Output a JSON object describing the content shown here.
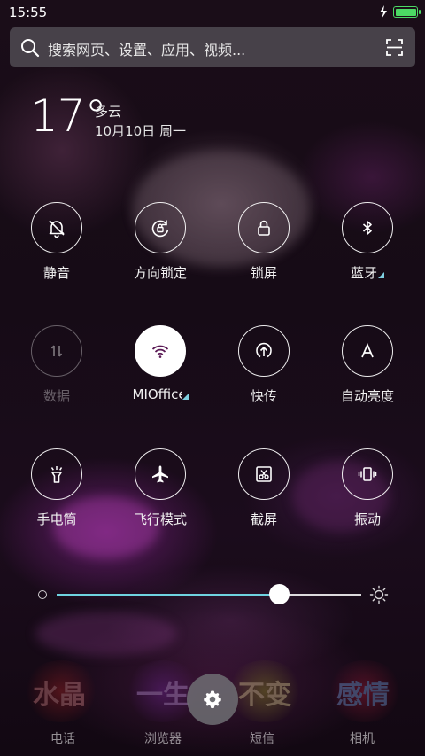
{
  "status_bar": {
    "time": "15:55",
    "battery_level_percent": 100
  },
  "search": {
    "placeholder": "搜索网页、设置、应用、视频..."
  },
  "weather": {
    "temperature": "17°",
    "condition": "多云",
    "date": "10月10日 周一"
  },
  "toggles": [
    {
      "label": "静音",
      "icon": "bell-off-icon",
      "state": "off"
    },
    {
      "label": "方向锁定",
      "icon": "rotation-lock-icon",
      "state": "off"
    },
    {
      "label": "锁屏",
      "icon": "lock-icon",
      "state": "off"
    },
    {
      "label": "蓝牙",
      "icon": "bluetooth-icon",
      "state": "off",
      "has_menu": true
    },
    {
      "label": "数据",
      "icon": "mobile-data-icon",
      "state": "disabled"
    },
    {
      "label": "MIOffice",
      "icon": "wifi-icon",
      "state": "on",
      "has_menu": true
    },
    {
      "label": "快传",
      "icon": "transfer-icon",
      "state": "off"
    },
    {
      "label": "自动亮度",
      "icon": "auto-brightness-icon",
      "state": "off"
    },
    {
      "label": "手电筒",
      "icon": "flashlight-icon",
      "state": "off"
    },
    {
      "label": "飞行模式",
      "icon": "airplane-icon",
      "state": "off"
    },
    {
      "label": "截屏",
      "icon": "screenshot-icon",
      "state": "off"
    },
    {
      "label": "振动",
      "icon": "vibrate-icon",
      "state": "off"
    }
  ],
  "brightness": {
    "level_fraction": 0.73
  },
  "dock": {
    "apps": [
      "电话",
      "浏览器",
      "短信",
      "相机"
    ],
    "tile_texts": [
      "水晶",
      "一生",
      "不变",
      "感情"
    ]
  },
  "colors": {
    "accent": "#6fd3e0",
    "battery": "#4cd964",
    "search_bg": "#6e6e73"
  }
}
